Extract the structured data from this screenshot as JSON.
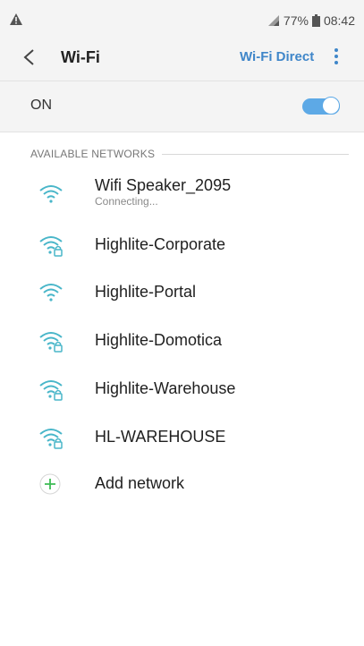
{
  "status_bar": {
    "battery": "77%",
    "time": "08:42"
  },
  "app_bar": {
    "title": "Wi-Fi",
    "wifi_direct_label": "Wi-Fi Direct"
  },
  "toggle": {
    "label": "ON",
    "enabled": true
  },
  "section": {
    "title": "AVAILABLE NETWORKS"
  },
  "networks": [
    {
      "name": "Wifi Speaker_2095",
      "status": "Connecting...",
      "secured": false
    },
    {
      "name": "Highlite-Corporate",
      "secured": true
    },
    {
      "name": "Highlite-Portal",
      "secured": false
    },
    {
      "name": "Highlite-Domotica",
      "secured": true
    },
    {
      "name": "Highlite-Warehouse",
      "secured": true
    },
    {
      "name": "HL-WAREHOUSE",
      "secured": true
    }
  ],
  "add_network": {
    "label": "Add network"
  },
  "colors": {
    "accent": "#3f86c9",
    "wifi_icon": "#49b6c9",
    "toggle_on": "#5da9e6",
    "add_icon": "#3dbb54"
  }
}
